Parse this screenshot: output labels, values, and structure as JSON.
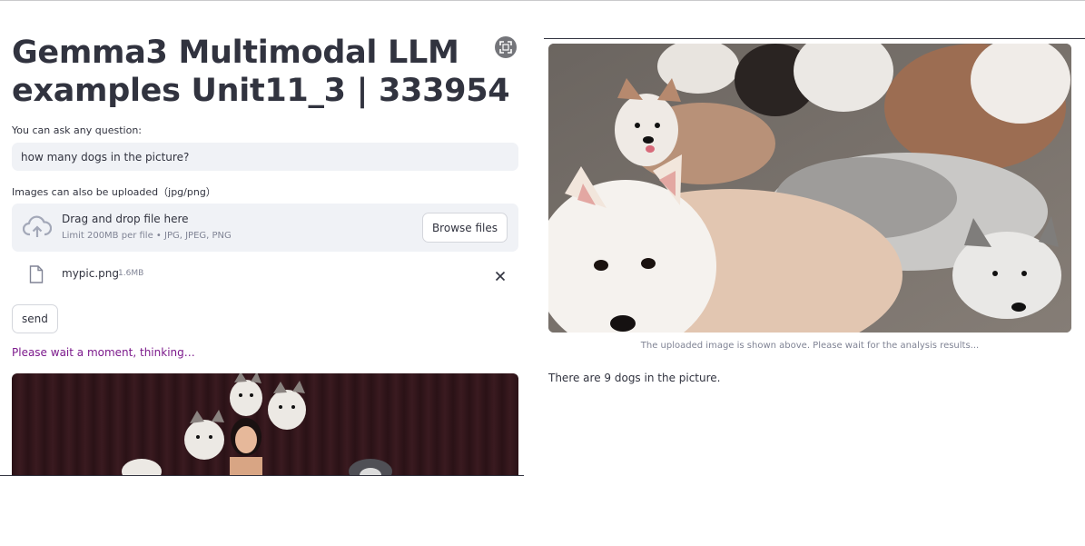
{
  "header": {
    "title": "Gemma3 Multimodal LLM examples Unit11_3 | 333954"
  },
  "question": {
    "label": "You can ask any question:",
    "value": "how many dogs in the picture?"
  },
  "uploader": {
    "label": "Images can also be uploaded（jpg/png）",
    "drop_title": "Drag and drop file here",
    "drop_subtitle": "Limit 200MB per file • JPG, JPEG, PNG",
    "browse_label": "Browse files",
    "file": {
      "name": "mypic.png",
      "size": "1.6MB"
    },
    "icons": {
      "upload": "cloud-upload-icon",
      "file": "file-icon",
      "remove": "close-icon",
      "fullscreen": "fullscreen-icon"
    }
  },
  "actions": {
    "send_label": "send",
    "status": "Please wait a moment, thinking…"
  },
  "result": {
    "caption": "The uploaded image is shown above. Please wait for the analysis results...",
    "answer": "There are 9 dogs in the picture."
  },
  "colors": {
    "text": "#31333f",
    "status": "#7c1a8c",
    "input_bg": "#f0f2f6",
    "muted": "#808495"
  }
}
